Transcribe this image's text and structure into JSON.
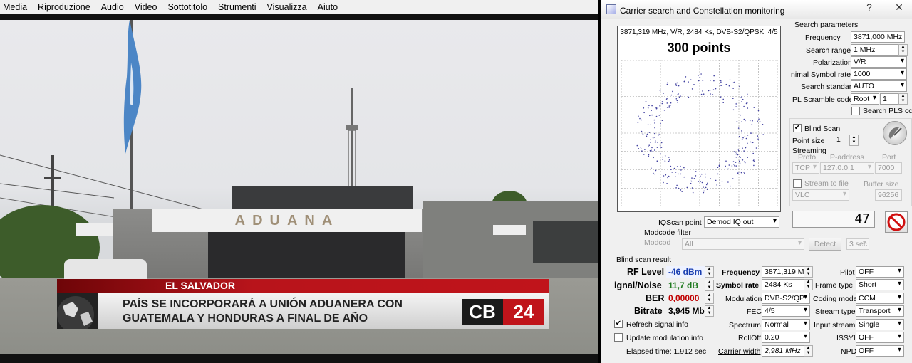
{
  "player": {
    "menu": [
      "Media",
      "Riproduzione",
      "Audio",
      "Video",
      "Sottotitolo",
      "Strumenti",
      "Visualizza",
      "Aiuto"
    ],
    "building_sign": "ADUANA",
    "ticker_tag": "EL SALVADOR",
    "headline_1": "PAÍS SE INCORPORARÁ A UNIÓN ADUANERA CON",
    "headline_2": "GUATEMALA Y HONDURAS A FINAL DE AÑO",
    "logo_left": "CB",
    "logo_right": "24"
  },
  "window": {
    "title": "Carrier search and Constellation monitoring",
    "help_glyph": "?",
    "close_glyph": "✕"
  },
  "constellation": {
    "header": "3871,319 MHz, V/R, 2484 Ks, DVB-S2/QPSK, 4/5",
    "title": "300 points"
  },
  "search": {
    "heading": "Search parameters",
    "frequency_label": "Frequency",
    "frequency_value": "3871,000 MHz",
    "range_label": "Search range",
    "range_value": "1 MHz",
    "polarization_label": "Polarization",
    "polarization_value": "V/R",
    "minsr_label": "nimal Symbol rate",
    "minsr_value": "1000",
    "standard_label": "Search standard",
    "standard_value": "AUTO",
    "pls_label": "PL Scramble code",
    "pls_mode": "Root",
    "pls_value": "1",
    "search_pls_label": "Search PLS cc"
  },
  "blind": {
    "blind_scan_label": "Blind Scan",
    "point_size_label": "Point size",
    "point_size_value": "1"
  },
  "streaming": {
    "heading": "Streaming",
    "proto_label": "Proto",
    "ip_label": "IP-address",
    "port_label": "Port",
    "proto_value": "TCP",
    "ip_value": "127.0.0.1",
    "port_value": "7000",
    "stream_to_file_label": "Stream to file",
    "buffer_label": "Buffer size",
    "player_value": "VLC",
    "buffer_value": "96256"
  },
  "iq": {
    "label": "IQScan point",
    "value": "Demod IQ out",
    "counter": "47"
  },
  "modcode": {
    "heading": "Modcode filter",
    "label": "Modcod",
    "value": "All",
    "detect": "Detect",
    "seconds": "3 sec"
  },
  "result": {
    "heading": "Blind scan result",
    "rf_label": "RF Level",
    "rf_value": "-46 dBm",
    "sn_label": "ignal/Noise",
    "sn_value": "11,7 dB",
    "ber_label": "BER",
    "ber_value": "0,00000",
    "bitrate_label": "Bitrate",
    "bitrate_value": "3,945 Mb",
    "freq_label": "Frequency",
    "freq_value": "3871,319 M",
    "sr_label": "Symbol rate",
    "sr_value": "2484 Ks",
    "mod_label": "Modulation",
    "mod_value": "DVB-S2/QP:",
    "fec_label": "FEC",
    "fec_value": "4/5",
    "spectrum_label": "Spectrum",
    "spectrum_value": "Normal",
    "rolloff_label": "RollOff",
    "rolloff_value": "0.20",
    "cw_label": "Carrier width",
    "cw_value": "2,981 MHz",
    "pilot_label": "Pilot",
    "pilot_value": "OFF",
    "frame_label": "Frame type",
    "frame_value": "Short",
    "coding_label": "Coding mode",
    "coding_value": "CCM",
    "stream_label": "Stream type",
    "stream_value": "Transport",
    "input_label": "Input stream",
    "input_value": "Single",
    "issyi_label": "ISSYI",
    "issyi_value": "OFF",
    "npd_label": "NPD",
    "npd_value": "OFF",
    "refresh_label": "Refresh signal info",
    "update_label": "Update modulation info",
    "elapsed": "Elapsed time: 1.912 sec"
  },
  "colors": {
    "rf": "#1a3fb0",
    "sn": "#1f7a1f",
    "ber": "#c00000",
    "ticker": "#b8141b"
  }
}
